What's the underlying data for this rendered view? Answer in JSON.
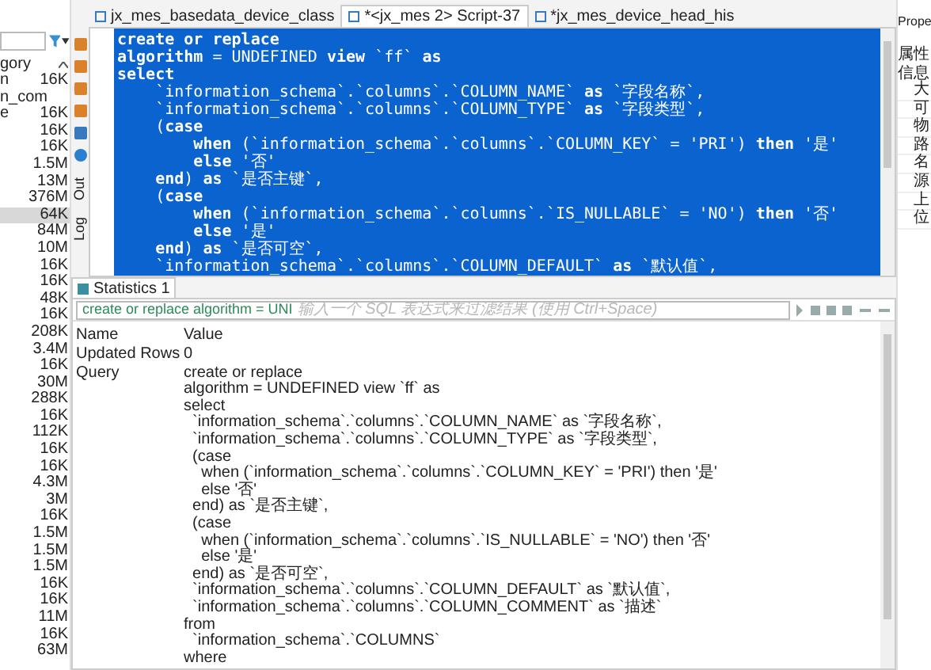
{
  "navigator": {
    "header": "gory",
    "rows": [
      {
        "name": "n",
        "size": "16K",
        "selected": false
      },
      {
        "name": "n_com",
        "selected": false
      },
      {
        "name": "e",
        "size": "16K",
        "selected": false
      },
      {
        "size": "16K",
        "selected": false
      },
      {
        "size": "16K",
        "selected": false
      },
      {
        "size": "1.5M",
        "selected": false
      },
      {
        "size": "13M",
        "selected": false
      },
      {
        "size": "376M",
        "selected": false
      },
      {
        "size": "64K",
        "selected": true
      },
      {
        "size": "84M",
        "selected": false
      },
      {
        "size": "10M",
        "selected": false
      },
      {
        "size": "16K",
        "selected": false
      },
      {
        "size": "16K",
        "selected": false
      },
      {
        "size": "48K",
        "selected": false
      },
      {
        "size": "16K",
        "selected": false
      },
      {
        "size": "208K",
        "selected": false
      },
      {
        "size": "3.4M",
        "selected": false
      },
      {
        "size": "16K",
        "selected": false
      },
      {
        "size": "30M",
        "selected": false
      },
      {
        "size": "288K",
        "selected": false
      },
      {
        "size": "16K",
        "selected": false
      },
      {
        "size": "112K",
        "selected": false
      },
      {
        "size": "16K",
        "selected": false
      },
      {
        "size": "16K",
        "selected": false
      },
      {
        "size": "4.3M",
        "selected": false
      },
      {
        "size": "3M",
        "selected": false
      },
      {
        "size": "16K",
        "selected": false
      },
      {
        "size": "1.5M",
        "selected": false
      },
      {
        "size": "1.5M",
        "selected": false
      },
      {
        "size": "1.5M",
        "selected": false
      },
      {
        "size": "16K",
        "selected": false
      },
      {
        "size": "16K",
        "selected": false
      },
      {
        "size": "11M",
        "selected": false
      },
      {
        "size": "16K",
        "selected": false
      },
      {
        "size": "63M",
        "selected": false
      }
    ]
  },
  "side_views": [
    "Out",
    "Log"
  ],
  "editor": {
    "tabs": [
      {
        "label": "jx_mes_basedata_device_class",
        "selected": false
      },
      {
        "label": "*<jx_mes 2> Script-37",
        "selected": true
      },
      {
        "label": "*jx_mes_device_head_his",
        "selected": false
      }
    ],
    "lines": [
      "**create** **or** **replace**",
      "**algorithm** = UNDEFINED **view** `ff` **as**",
      "**select**",
      "    `information_schema`.`columns`.`COLUMN_NAME` **as** `字段名称`,",
      "    `information_schema`.`columns`.`COLUMN_TYPE` **as** `字段类型`,",
      "    (**case**",
      "        **when** (`information_schema`.`columns`.`COLUMN_KEY` = 'PRI') **then** '是'",
      "        **else** '否'",
      "    **end**) **as** `是否主键`,",
      "    (**case**",
      "        **when** (`information_schema`.`columns`.`IS_NULLABLE` = 'NO') **then** '否'",
      "        **else** '是'",
      "    **end**) **as** `是否可空`,",
      "    `information_schema`.`columns`.`COLUMN_DEFAULT` **as** `默认值`,"
    ]
  },
  "properties": {
    "tab": "Prope",
    "header": "属性",
    "group": "信息",
    "rows": [
      "大",
      "可",
      "物",
      "路",
      "名",
      "源",
      "上",
      "位"
    ]
  },
  "statistics": {
    "tab": "Statistics 1",
    "filter_value": "create or replace algorithm = UNI",
    "filter_placeholder": "输入一个 SQL 表达式来过滤结果 (使用 Ctrl+Space)",
    "columns": [
      "Name",
      "Value"
    ],
    "rows": [
      {
        "name": "Updated Rows",
        "value": [
          "0"
        ]
      },
      {
        "name": "Query",
        "value": [
          "create or replace",
          "algorithm = UNDEFINED view `ff` as",
          "select",
          "  `information_schema`.`columns`.`COLUMN_NAME` as `字段名称`,",
          "  `information_schema`.`columns`.`COLUMN_TYPE` as `字段类型`,",
          "  (case",
          "    when (`information_schema`.`columns`.`COLUMN_KEY` = 'PRI') then '是'",
          "    else '否'",
          "  end) as `是否主键`,",
          "  (case",
          "    when (`information_schema`.`columns`.`IS_NULLABLE` = 'NO') then '否'",
          "    else '是'",
          "  end) as `是否可空`,",
          "  `information_schema`.`columns`.`COLUMN_DEFAULT` as `默认值`,",
          "  `information_schema`.`columns`.`COLUMN_COMMENT` as `描述`",
          "from",
          "  `information_schema`.`COLUMNS`",
          "where"
        ]
      }
    ]
  }
}
